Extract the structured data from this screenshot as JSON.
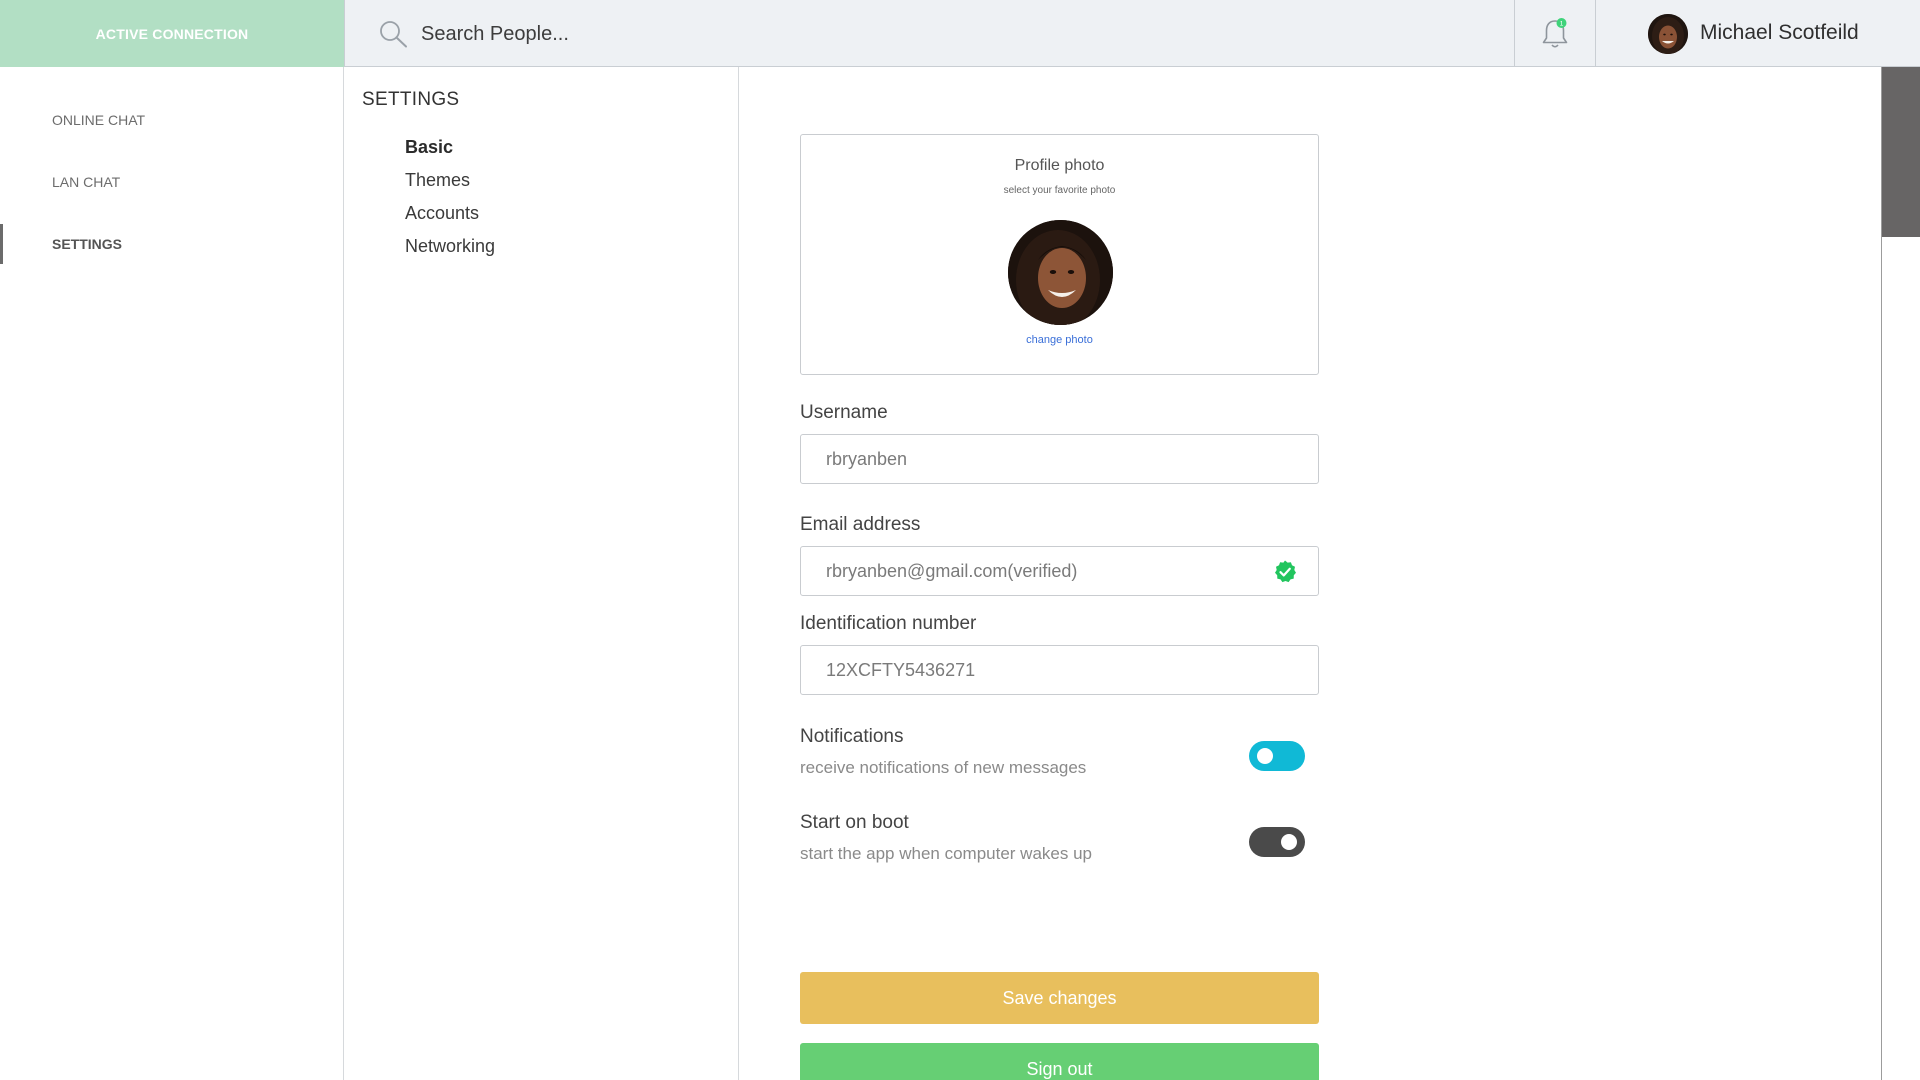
{
  "header": {
    "connection_label": "ACTIVE CONNECTION",
    "search_placeholder": "Search People...",
    "search_icon": "search-icon",
    "notification_icon": "bell-icon",
    "notification_count": "1",
    "user_name": "Michael Scotfeild"
  },
  "leftnav": {
    "items": [
      {
        "label": "ONLINE CHAT",
        "active": false
      },
      {
        "label": "LAN CHAT",
        "active": false
      },
      {
        "label": "SETTINGS",
        "active": true
      }
    ]
  },
  "settings_menu": {
    "title": "SETTINGS",
    "items": [
      {
        "label": "Basic",
        "active": true
      },
      {
        "label": "Themes",
        "active": false
      },
      {
        "label": "Accounts",
        "active": false
      },
      {
        "label": "Networking",
        "active": false
      }
    ]
  },
  "profile": {
    "title": "Profile photo",
    "subtitle": "select your favorite photo",
    "change_link": "change photo"
  },
  "form": {
    "username_label": "Username",
    "username_value": "rbryanben",
    "email_label": "Email address",
    "email_value": "rbryanben@gmail.com(verified)",
    "email_verified_icon": "verified-check-icon",
    "id_label": "Identification number",
    "id_value": "12XCFTY5436271"
  },
  "toggles": {
    "notifications_title": "Notifications",
    "notifications_desc": "receive notifications of new messages",
    "notifications_on": true,
    "boot_title": "Start on boot",
    "boot_desc": "start the app when computer wakes up",
    "boot_on": false
  },
  "buttons": {
    "save_label": "Save changes",
    "signout_label": "Sign out"
  },
  "colors": {
    "connection_bg": "#b2dfc4",
    "toggle_on": "#10b9d6",
    "toggle_off": "#4a4a4a",
    "save": "#e8bf5d",
    "signout": "#66cf74",
    "verified": "#22c55e",
    "link": "#3a6fd8"
  }
}
